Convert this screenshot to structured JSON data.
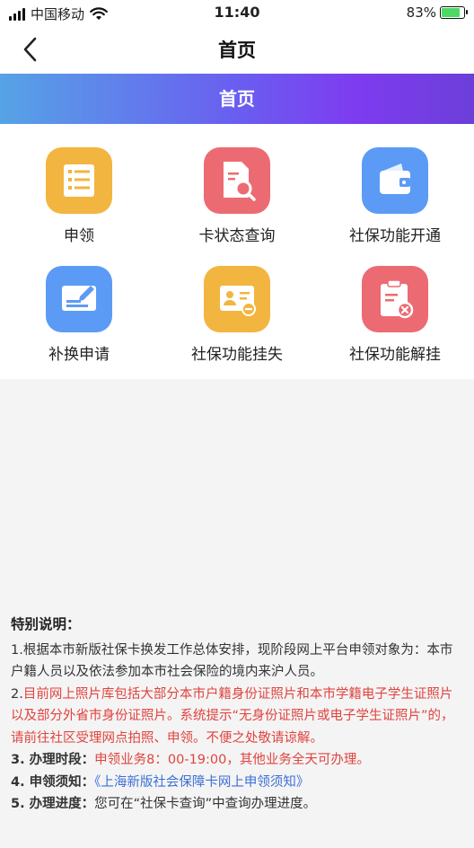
{
  "status_bar": {
    "carrier": "中国移动",
    "time": "11:40",
    "battery": "83%",
    "battery_level": 0.83
  },
  "nav": {
    "title": "首页"
  },
  "banner": {
    "title": "首页"
  },
  "menu": [
    {
      "label": "申领",
      "icon": "list-icon",
      "color": "#f2b53f"
    },
    {
      "label": "卡状态查询",
      "icon": "document-search-icon",
      "color": "#ec6b73"
    },
    {
      "label": "社保功能开通",
      "icon": "wallet-icon",
      "color": "#5c9bf5"
    },
    {
      "label": "补换申请",
      "icon": "edit-card-icon",
      "color": "#5c9bf5"
    },
    {
      "label": "社保功能挂失",
      "icon": "id-card-minus-icon",
      "color": "#f2b53f"
    },
    {
      "label": "社保功能解挂",
      "icon": "clipboard-cancel-icon",
      "color": "#ec6b73"
    }
  ],
  "notes": {
    "heading": "特别说明：",
    "p1": "1.根据本市新版社保卡换发工作总体安排，现阶段网上平台申领对象为：本市户籍人员以及依法参加本市社会保险的境内来沪人员。",
    "p2_num": "2.",
    "p2": "目前网上照片库包括大部分本市户籍身份证照片和本市学籍电子学生证照片以及部分外省市身份证照片。系统提示“无身份证照片或电子学生证照片”的，请前往社区受理网点拍照、申领。不便之处敬请谅解。",
    "p3_label": "3. 办理时段：",
    "p3": "申领业务8：00-19:00，其他业务全天可办理。",
    "p4_label": "4. 申领须知：",
    "p4_link": "《上海新版社会保障卡网上申领须知》",
    "p5_label": "5. 办理进度：",
    "p5": "您可在“社保卡查询”中查询办理进度。"
  }
}
